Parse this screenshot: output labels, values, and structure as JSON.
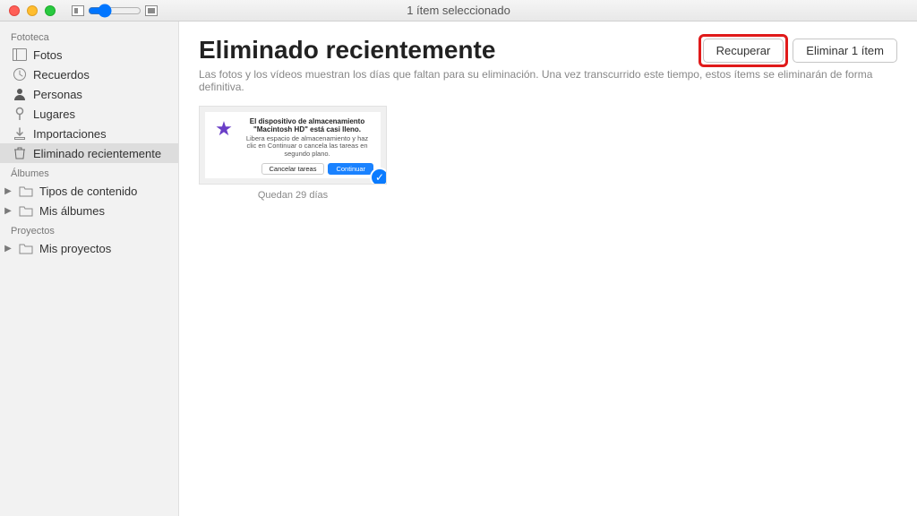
{
  "titlebar": {
    "title": "1 ítem seleccionado"
  },
  "sidebar": {
    "sections": {
      "fototeca": {
        "title": "Fototeca",
        "items": {
          "fotos": "Fotos",
          "recuerdos": "Recuerdos",
          "personas": "Personas",
          "lugares": "Lugares",
          "importaciones": "Importaciones",
          "eliminado": "Eliminado recientemente"
        }
      },
      "albumes": {
        "title": "Álbumes",
        "items": {
          "tipos": "Tipos de contenido",
          "mis_albumes": "Mis álbumes"
        }
      },
      "proyectos": {
        "title": "Proyectos",
        "items": {
          "mis_proyectos": "Mis proyectos"
        }
      }
    }
  },
  "main": {
    "title": "Eliminado recientemente",
    "recover_btn": "Recuperar",
    "delete_btn": "Eliminar 1 ítem",
    "info": "Las fotos y los vídeos muestran los días que faltan para su eliminación. Una vez transcurrido este tiempo, estos ítems se eliminarán de forma definitiva.",
    "item": {
      "dialog_title": "El dispositivo de almacenamiento \"Macintosh HD\" está casi lleno.",
      "dialog_body": "Libera espacio de almacenamiento y haz clic en Continuar o cancela las tareas en segundo plano.",
      "cancel": "Cancelar tareas",
      "continue": "Continuar",
      "caption": "Quedan 29 días"
    }
  }
}
